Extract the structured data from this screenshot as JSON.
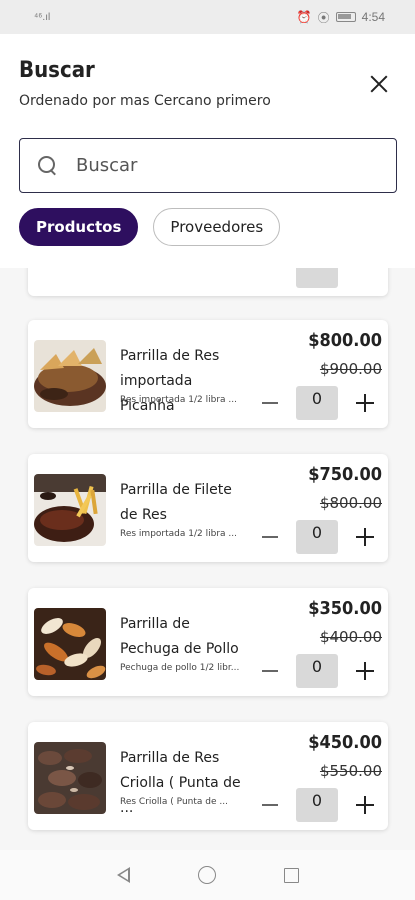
{
  "status_bar": {
    "time": "4:54",
    "signal": "⁴⁶.ıl"
  },
  "header": {
    "title": "Buscar",
    "subtitle": "Ordenado por mas Cercano primero"
  },
  "search": {
    "placeholder": "Buscar",
    "value": ""
  },
  "tabs": [
    {
      "label": "Productos",
      "active": true
    },
    {
      "label": "Proveedores",
      "active": false
    }
  ],
  "products": [
    {
      "name": "Parrilla de Res importada Picanha",
      "description": "Res importada 1/2 libra ...",
      "price": "$800.00",
      "old_price": "$900.00",
      "quantity": "0",
      "image": "picanha-steak"
    },
    {
      "name": "Parrilla de Filete de Res",
      "description": "Res importada 1/2 libra ...",
      "price": "$750.00",
      "old_price": "$800.00",
      "quantity": "0",
      "image": "beef-fillet-fries"
    },
    {
      "name": "Parrilla de Pechuga de Pollo",
      "description": "Pechuga de pollo 1/2 libr...",
      "price": "$350.00",
      "old_price": "$400.00",
      "quantity": "0",
      "image": "grilled-chicken"
    },
    {
      "name": "Parrilla de Res Criolla ( Punta de ...",
      "description": "Res Criolla ( Punta de ...",
      "price": "$450.00",
      "old_price": "$550.00",
      "quantity": "0",
      "image": "creole-beef"
    }
  ],
  "colors": {
    "accent": "#2e0f5f",
    "card_bg": "#ffffff",
    "qty_bg": "#d9d9d9"
  }
}
